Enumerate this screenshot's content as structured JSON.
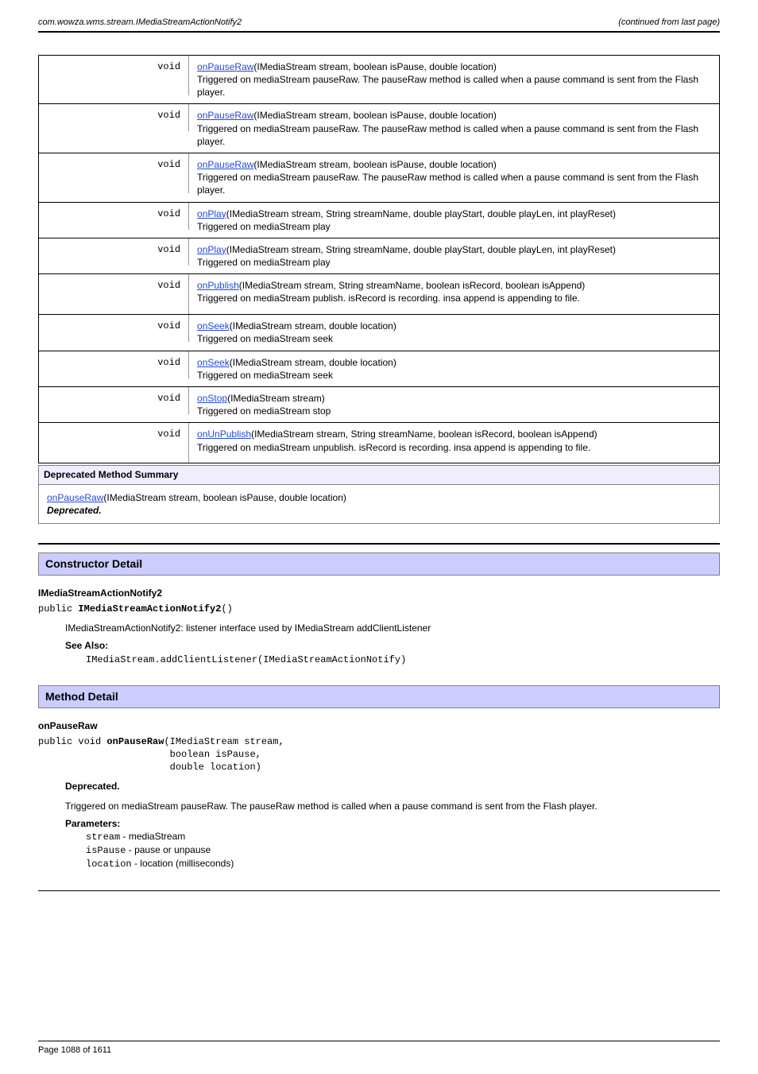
{
  "header": {
    "left": "com.wowza.wms.stream.IMediaStreamActionNotify2",
    "right": "(continued from last page)"
  },
  "rows": [
    {
      "ret": "void",
      "link": "onPauseRaw",
      "sig": "(IMediaStream stream, boolean isPause, double location)",
      "desc": "Triggered on mediaStream pauseRaw. The pauseRaw method is called when a pause command is sent from the Flash player.",
      "tall": true
    },
    {
      "ret": "void",
      "link": "onPauseRaw",
      "sig": "(IMediaStream stream, boolean isPause, double location)",
      "desc": "Triggered on mediaStream pauseRaw. The pauseRaw method is called when a pause command is sent from the Flash player.",
      "tall": false
    },
    {
      "ret": "void",
      "link": "onPauseRaw",
      "sig": "(IMediaStream stream, boolean isPause, double location)",
      "desc": "Triggered on mediaStream pauseRaw. The pauseRaw method is called when a pause command is sent from the Flash player.",
      "tall": true
    },
    {
      "ret": "void",
      "link": "onPlay",
      "sig": "(IMediaStream stream, String streamName, double playStart, double playLen, int playReset)",
      "desc": "Triggered on mediaStream play",
      "tall": false
    },
    {
      "ret": "void",
      "link": "onPlay",
      "sig": "(IMediaStream stream, String streamName, double playStart, double playLen, int playReset)",
      "desc": "Triggered on mediaStream play",
      "tall": false
    },
    {
      "ret": "void",
      "link": "onPublish",
      "sig": "(IMediaStream stream, String streamName, boolean isRecord, boolean isAppend)",
      "desc": "Triggered on mediaStream publish. isRecord is recording. insa append is appending to file.",
      "tall": true
    },
    {
      "ret": "void",
      "link": "onSeek",
      "sig": "(IMediaStream stream, double location)",
      "desc": "Triggered on mediaStream seek",
      "tall": false
    },
    {
      "ret": "void",
      "link": "onSeek",
      "sig": "(IMediaStream stream, double location)",
      "desc": "Triggered on mediaStream seek",
      "tall": false
    },
    {
      "ret": "void",
      "link": "onStop",
      "sig": "(IMediaStream stream)",
      "desc": "Triggered on mediaStream stop",
      "tall": false
    },
    {
      "ret": "void",
      "link": "onUnPublish",
      "sig": "(IMediaStream stream, String streamName, boolean isRecord, boolean isAppend)",
      "desc": "Triggered on mediaStream unpublish. isRecord is recording. insa append is appending to file.",
      "tall": true
    }
  ],
  "deprecated": {
    "title": "Deprecated Method Summary",
    "link": "onPauseRaw",
    "sig": "(IMediaStream stream, boolean isPause, double location)",
    "note": "Deprecated."
  },
  "constructor": {
    "heading": "Constructor Detail",
    "name": "IMediaStreamActionNotify2",
    "sig_pre": "public ",
    "sig_name": "IMediaStreamActionNotify2",
    "sig_post": "()",
    "desc": "IMediaStreamActionNotify2: listener interface used by IMediaStream addClientListener",
    "see_also_label": "See Also:",
    "see_also_code": "IMediaStream.addClientListener(IMediaStreamActionNotify)"
  },
  "method_detail": {
    "heading": "Method Detail",
    "name": "onPauseRaw",
    "sig_pre": "public void ",
    "sig_name": "onPauseRaw",
    "sig_args_line1": "(IMediaStream stream,",
    "sig_args_line2": "                       boolean isPause,",
    "sig_args_line3": "                       double location)",
    "deprecated": "Deprecated.",
    "desc": "Triggered on mediaStream pauseRaw. The pauseRaw method is called when a pause command is sent from the Flash player.",
    "params_label": "Parameters:",
    "params": [
      {
        "name": "stream",
        "desc": " - mediaStream"
      },
      {
        "name": "isPause",
        "desc": " - pause or unpause"
      },
      {
        "name": "location",
        "desc": " - location (milliseconds)"
      }
    ]
  },
  "footer": {
    "left": "Page 1088 of 1611",
    "right": ""
  }
}
